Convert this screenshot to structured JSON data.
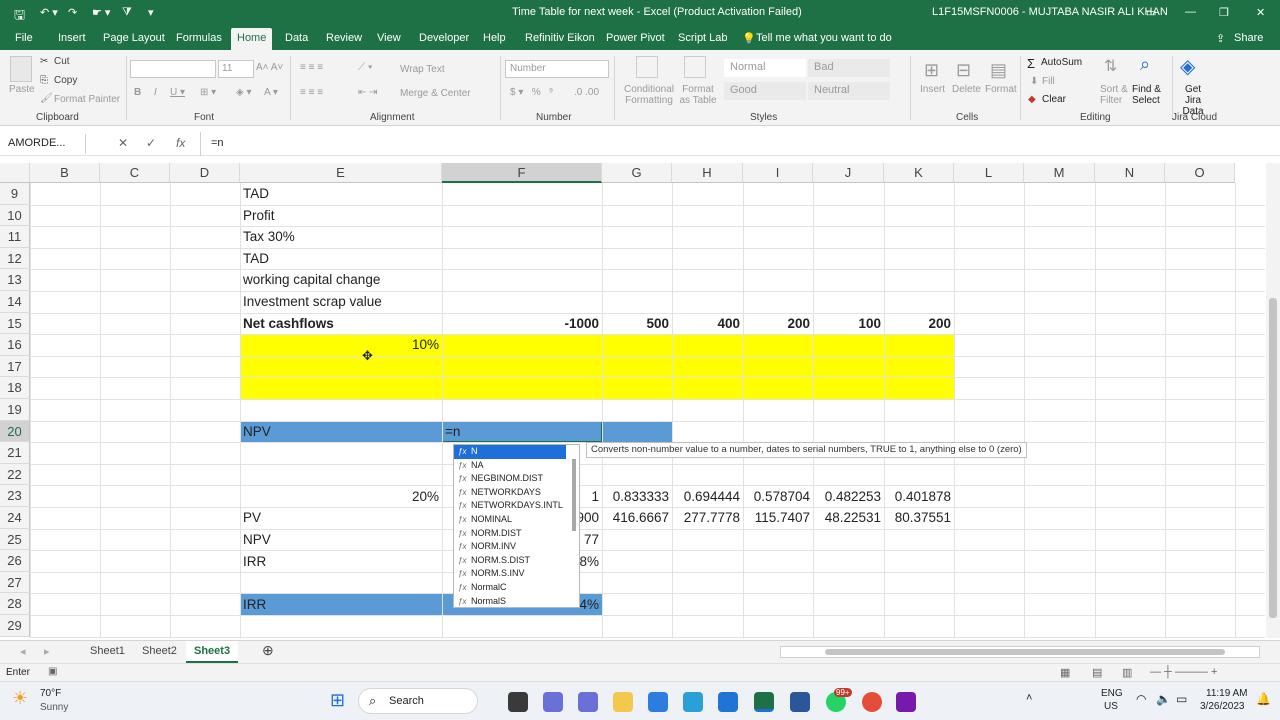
{
  "title_bar": {
    "doc_title": "Time Table for next week  -  Excel (Product Activation Failed)",
    "user": "L1F15MSFN0006 - MUJTABA NASIR ALI KHAN"
  },
  "tabs": [
    "File",
    "Insert",
    "Page Layout",
    "Formulas",
    "Home",
    "Data",
    "Review",
    "View",
    "Developer",
    "Help",
    "Refinitiv Eikon",
    "Power Pivot",
    "Script Lab"
  ],
  "tell_me": "Tell me what you want to do",
  "share": "Share",
  "ribbon": {
    "paste": "Paste",
    "cut": "Cut",
    "copy": "Copy",
    "format_painter": "Format Painter",
    "font_size": "11",
    "wrap_text": "Wrap Text",
    "merge_center": "Merge & Center",
    "number_format": "Number",
    "conditional_formatting": "Conditional Formatting",
    "format_as_table": "Format as Table",
    "style_normal": "Normal",
    "style_bad": "Bad",
    "style_good": "Good",
    "style_neutral": "Neutral",
    "insert": "Insert",
    "delete": "Delete",
    "format": "Format",
    "autosum": "AutoSum",
    "fill": "Fill",
    "clear": "Clear",
    "sort_filter": "Sort & Filter",
    "find_select": "Find & Select",
    "jira_data": "Get Jira Data",
    "groups": [
      "Clipboard",
      "Font",
      "Alignment",
      "Number",
      "Styles",
      "Cells",
      "Editing",
      "Jira Cloud"
    ]
  },
  "formula_bar": {
    "name_box": "AMORDE...",
    "formula": "=n"
  },
  "columns": [
    "B",
    "C",
    "D",
    "E",
    "F",
    "G",
    "H",
    "I",
    "J",
    "K",
    "L",
    "M",
    "N",
    "O"
  ],
  "rows": [
    "9",
    "10",
    "11",
    "12",
    "13",
    "14",
    "15",
    "16",
    "17",
    "18",
    "19",
    "20",
    "21",
    "22",
    "23",
    "24",
    "25",
    "26",
    "27",
    "28",
    "29"
  ],
  "cells": {
    "E9": "TAD",
    "E10": "Profit",
    "E11": "Tax 30%",
    "E12": "TAD",
    "E13": "working capital change",
    "E14": "Investment scrap value",
    "E15": "Net cashflows",
    "F15": "-1000",
    "G15": "500",
    "H15": "400",
    "I15": "200",
    "J15": "100",
    "K15": "200",
    "E16": "10%",
    "E20": "NPV",
    "F20": "=n",
    "E23": "20%",
    "F23": "1",
    "G23": "0.833333",
    "H23": "0.694444",
    "I23": "0.578704",
    "J23": "0.482253",
    "K23": "0.401878",
    "E24": "PV",
    "F24": "900",
    "G24": "416.6667",
    "H24": "277.7778",
    "I24": "115.7407",
    "J24": "48.22531",
    "K24": "80.37551",
    "E25": "NPV",
    "F25": "77",
    "E26": "IRR",
    "F26": "8%",
    "E28": "IRR",
    "F28": "4%"
  },
  "autocomplete": [
    "N",
    "NA",
    "NEGBINOM.DIST",
    "NETWORKDAYS",
    "NETWORKDAYS.INTL",
    "NOMINAL",
    "NORM.DIST",
    "NORM.INV",
    "NORM.S.DIST",
    "NORM.S.INV",
    "NormalC",
    "NormalS"
  ],
  "tooltip": "Converts non-number value to a number, dates to serial numbers, TRUE to 1, anything else to 0 (zero)",
  "sheets": [
    "Sheet1",
    "Sheet2",
    "Sheet3"
  ],
  "status": {
    "mode": "Enter"
  },
  "taskbar": {
    "weather_temp": "70°F",
    "weather_desc": "Sunny",
    "search": "Search",
    "lang1": "ENG",
    "lang2": "US",
    "time": "11:19 AM",
    "date": "3/26/2023",
    "badge": "99+"
  },
  "colors": {
    "excel_green": "#1e7145",
    "highlight_yellow": "#ffff00",
    "highlight_blue": "#5b9bd5"
  }
}
